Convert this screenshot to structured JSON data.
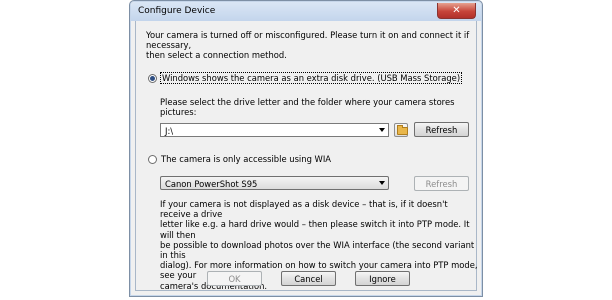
{
  "window": {
    "title": "Configure Device",
    "close_glyph": "✕"
  },
  "intro": {
    "text": "Your camera is turned off or misconfigured. Please turn it on and connect it if necessary,\nthen select a connection method."
  },
  "option_disk": {
    "label": "Windows shows the camera as an extra disk drive. (USB Mass Storage)",
    "selected": true,
    "prompt": "Please select the drive letter and the folder where your camera stores pictures:",
    "drive_value": "J:\\",
    "browse_icon": "folder-icon",
    "refresh_label": "Refresh"
  },
  "option_wia": {
    "label": "The camera is only accessible using WIA",
    "selected": false,
    "device_value": "Canon PowerShot S95",
    "refresh_label": "Refresh",
    "info": "If your camera is not displayed as a disk device – that is, if it doesn't receive a drive\nletter like e.g. a hard drive would – then please switch it into PTP mode. It will then\nbe possible to download photos over the WIA interface (the second variant in this\ndialog). For more information on how to switch your camera into PTP mode, see your\ncamera's documentation."
  },
  "footer": {
    "ok_label": "OK",
    "cancel_label": "Cancel",
    "ignore_label": "Ignore"
  }
}
